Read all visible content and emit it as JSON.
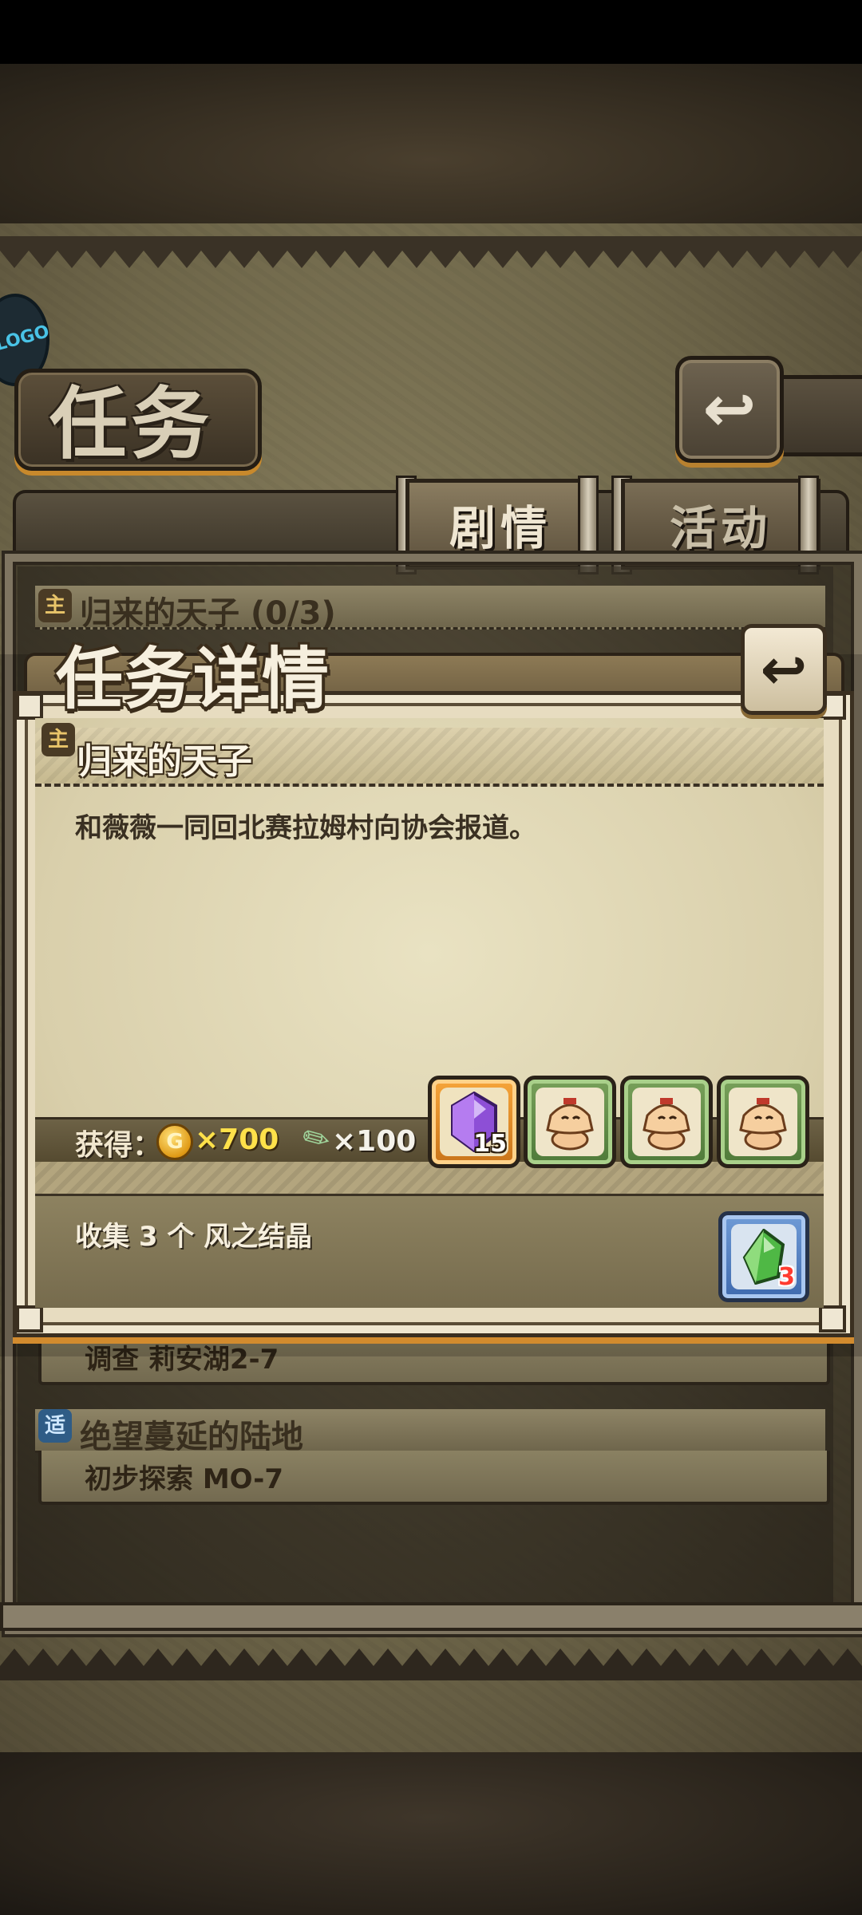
{
  "header": {
    "title": "任务",
    "logo_text": "LOGO"
  },
  "tabs": [
    {
      "label": "剧情",
      "active": true
    },
    {
      "label": "活动",
      "active": false
    }
  ],
  "quest_list": [
    {
      "tag": "主",
      "title": "归来的天子 (0/3)",
      "objective": ""
    },
    {
      "tag": "",
      "title": "",
      "objective": "调查 莉安湖2-7"
    },
    {
      "tag": "适",
      "title": "绝望蔓延的陆地",
      "objective": "初步探索 MO-7"
    }
  ],
  "modal": {
    "title": "任务详情",
    "quest_tag": "主",
    "quest_title": "归来的天子",
    "description": "和薇薇一同回北赛拉姆村向协会报道。",
    "reward_label": "获得：",
    "gold_symbol": "G",
    "gold_amount": "×700",
    "exp_amount": "×100",
    "reward_items": [
      {
        "name": "purple-crystal",
        "quantity": "15"
      },
      {
        "name": "doll-figure",
        "quantity": ""
      },
      {
        "name": "doll-figure",
        "quantity": ""
      },
      {
        "name": "doll-figure",
        "quantity": ""
      }
    ],
    "objective_text": "收集 3 个 风之结晶",
    "objective_item_quantity": "3"
  },
  "colors": {
    "gold": "#ffe14a",
    "accent_orange": "#d28b2e",
    "parchment": "#e7dcc0"
  }
}
